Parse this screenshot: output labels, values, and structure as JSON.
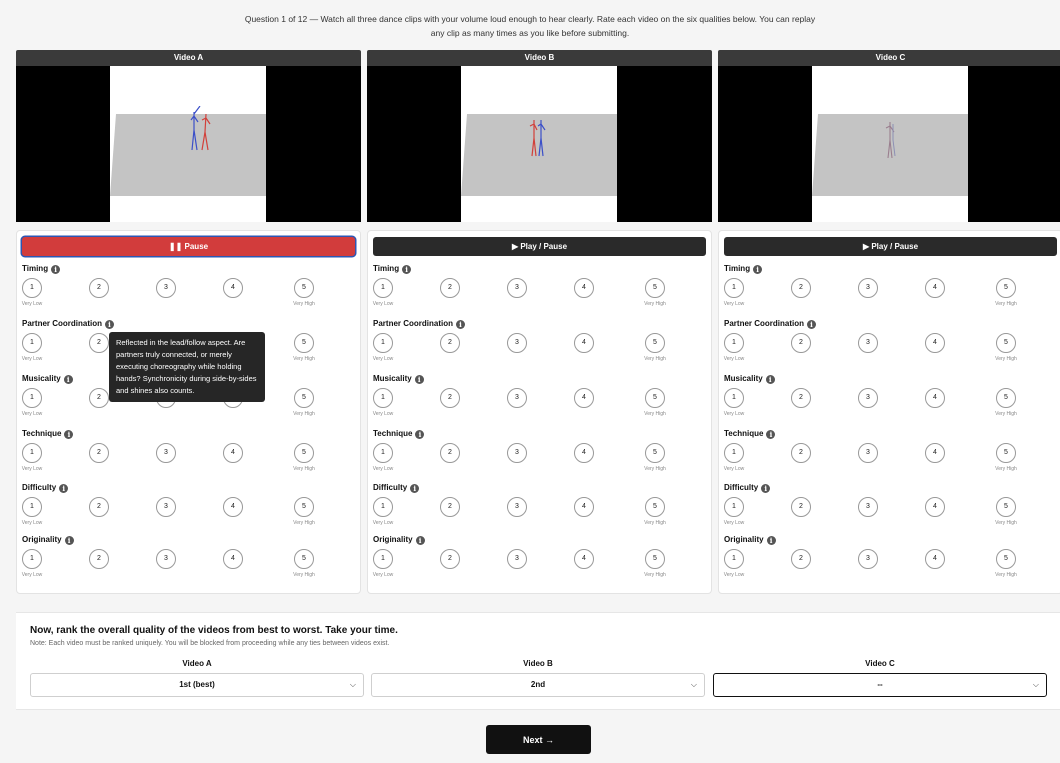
{
  "instructions": "Question 1 of 12 — Watch all three dance clips with your volume loud enough to hear clearly. Rate each video on the six qualities below. You can replay any clip as many times as you like before submitting.",
  "scale": {
    "options": [
      "1",
      "2",
      "3",
      "4",
      "5"
    ],
    "low_label": "Very Low",
    "high_label": "Very High"
  },
  "info_glyph": "i",
  "qualities": [
    "Timing",
    "Partner Coordination",
    "Musicality",
    "Technique",
    "Difficulty",
    "Originality"
  ],
  "videos": [
    {
      "title": "Video A",
      "button_label": "❚❚ Pause",
      "state": "playing"
    },
    {
      "title": "Video B",
      "button_label": "▶ Play / Pause",
      "state": "idle"
    },
    {
      "title": "Video C",
      "button_label": "▶ Play / Pause",
      "state": "idle"
    }
  ],
  "tooltip": {
    "text": "Reflected in the lead/follow aspect. Are partners truly connected, or merely executing choreography while holding hands? Synchronicity during side-by-sides and shines also counts."
  },
  "ranking": {
    "title": "Now, rank the overall quality of the videos from best to worst. Take your time.",
    "note": "Note: Each video must be ranked uniquely. You will be blocked from proceeding while any ties between videos exist.",
    "selects": [
      {
        "label": "Video A",
        "value": "1st (best)"
      },
      {
        "label": "Video B",
        "value": "2nd"
      },
      {
        "label": "Video C",
        "value": "--"
      }
    ]
  },
  "next_label": "Next →",
  "colors": {
    "pause_button": "#d23c3c",
    "dark_button": "#2a2a2a",
    "lead_dancer": "#3b4fc9",
    "follow_dancer": "#d2403a"
  }
}
